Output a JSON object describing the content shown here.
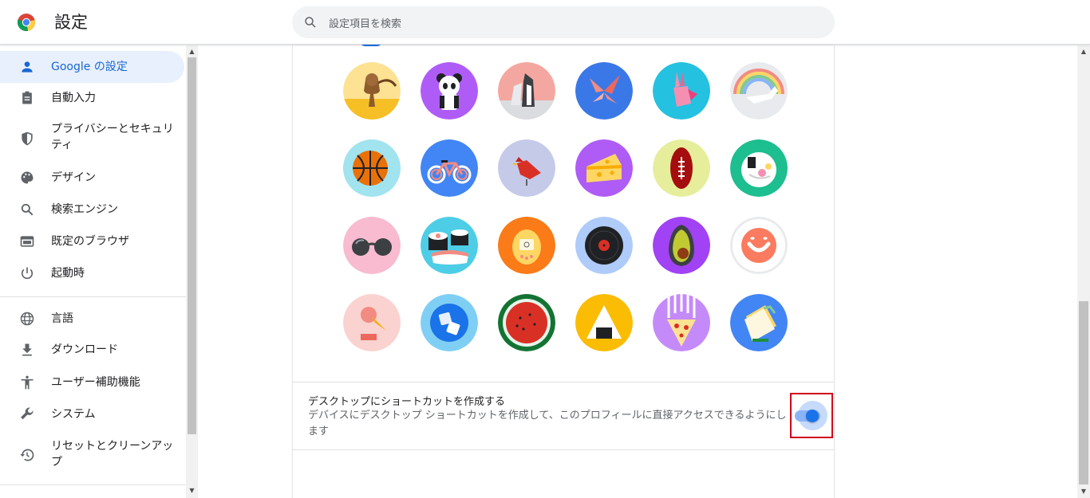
{
  "header": {
    "title": "設定",
    "search_placeholder": "設定項目を検索"
  },
  "sidebar": {
    "items": [
      {
        "label": "Google の設定",
        "icon": "person-icon",
        "active": true
      },
      {
        "label": "自動入力",
        "icon": "clipboard-icon"
      },
      {
        "label": "プライバシーとセキュリティ",
        "icon": "shield-icon"
      },
      {
        "label": "デザイン",
        "icon": "palette-icon"
      },
      {
        "label": "検索エンジン",
        "icon": "search-icon"
      },
      {
        "label": "既定のブラウザ",
        "icon": "browser-icon"
      },
      {
        "label": "起動時",
        "icon": "power-icon"
      },
      {
        "label": "言語",
        "icon": "globe-icon"
      },
      {
        "label": "ダウンロード",
        "icon": "download-icon"
      },
      {
        "label": "ユーザー補助機能",
        "icon": "accessibility-icon"
      },
      {
        "label": "システム",
        "icon": "wrench-icon"
      },
      {
        "label": "リセットとクリーンアップ",
        "icon": "restore-icon"
      }
    ]
  },
  "avatars": [
    "monkey",
    "panda",
    "penguin",
    "butterfly",
    "rabbit",
    "unicorn",
    "basketball",
    "bicycle",
    "bird",
    "cheese",
    "football",
    "ramen",
    "sunglasses",
    "sushi",
    "tamagotchi",
    "vinyl-record",
    "avocado",
    "smiley",
    "ice-cream",
    "ice-cubes",
    "watermelon",
    "onigiri",
    "pizza",
    "sandwich"
  ],
  "shortcut": {
    "title": "デスクトップにショートカットを作成する",
    "description": "デバイスにデスクトップ ショートカットを作成して、このプロフィールに直接アクセスできるようにします",
    "enabled": true
  },
  "colors": {
    "accent": "#1a73e8",
    "active_bg": "#e8f0fe",
    "highlight_border": "#d0021b"
  }
}
